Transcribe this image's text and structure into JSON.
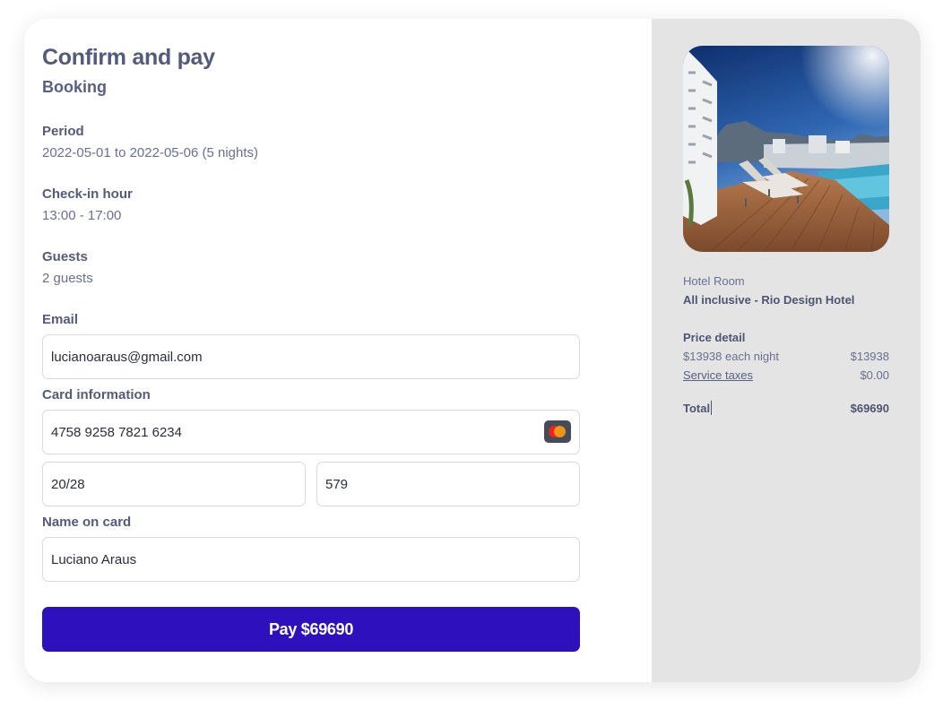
{
  "checkout": {
    "title": "Confirm and pay",
    "subtitle": "Booking",
    "period": {
      "label": "Period",
      "value": "2022-05-01 to 2022-05-06 (5 nights)"
    },
    "checkin": {
      "label": "Check-in hour",
      "value": "13:00 - 17:00"
    },
    "guests": {
      "label": "Guests",
      "value": "2 guests"
    },
    "email": {
      "label": "Email",
      "value": "lucianoaraus@gmail.com"
    },
    "card": {
      "label": "Card information",
      "number": "4758 9258 7821 6234",
      "expiry": "20/28",
      "cvc": "579",
      "brand_icon": "mastercard-icon"
    },
    "name_on_card": {
      "label": "Name on card",
      "value": "Luciano Araus"
    },
    "pay_button": "Pay $69690",
    "button_color": "#2e10bd"
  },
  "summary": {
    "room_type": "Hotel Room",
    "room_name": "All inclusive - Rio Design Hotel",
    "price_detail_title": "Price detail",
    "nightly_label": "$13938 each night",
    "nightly_amount": "$13938",
    "taxes_label": "Service taxes",
    "taxes_amount": "$0.00",
    "total_label": "Total",
    "total_amount": "$69690"
  }
}
